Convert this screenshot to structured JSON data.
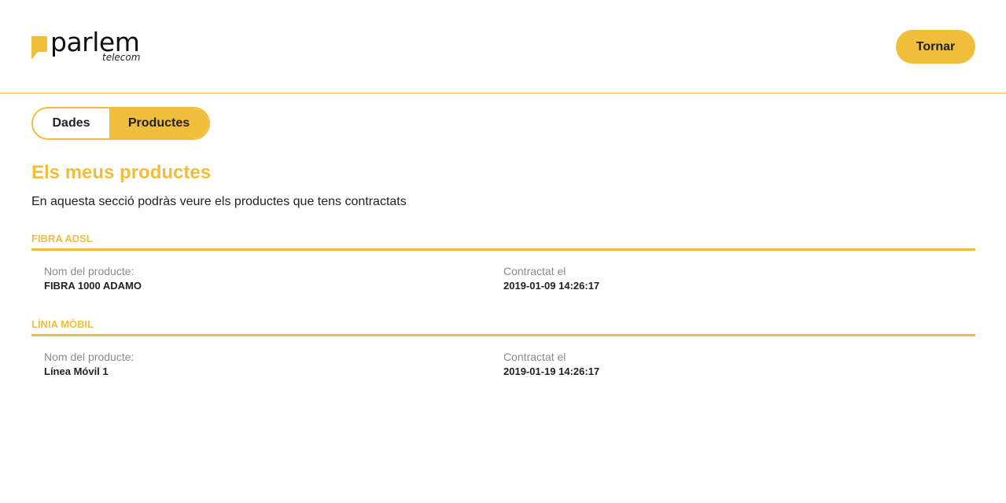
{
  "brand": {
    "name": "parlem",
    "sub": "telecom",
    "accent_color": "#f0be3b"
  },
  "header": {
    "back_label": "Tornar"
  },
  "tabs": [
    {
      "label": "Dades",
      "active": false
    },
    {
      "label": "Productes",
      "active": true
    }
  ],
  "main": {
    "title": "Els meus productes",
    "description": "En aquesta secció podràs veure els productes que tens contractats"
  },
  "products": [
    {
      "category": "FIBRA ADSL",
      "name_label": "Nom del producte:",
      "name_value": "FIBRA 1000 ADAMO",
      "date_label": "Contractat el",
      "date_value": "2019-01-09 14:26:17"
    },
    {
      "category": "LÍNIA MÒBIL",
      "name_label": "Nom del producte:",
      "name_value": "Línea Móvil 1",
      "date_label": "Contractat el",
      "date_value": "2019-01-19 14:26:17"
    }
  ]
}
